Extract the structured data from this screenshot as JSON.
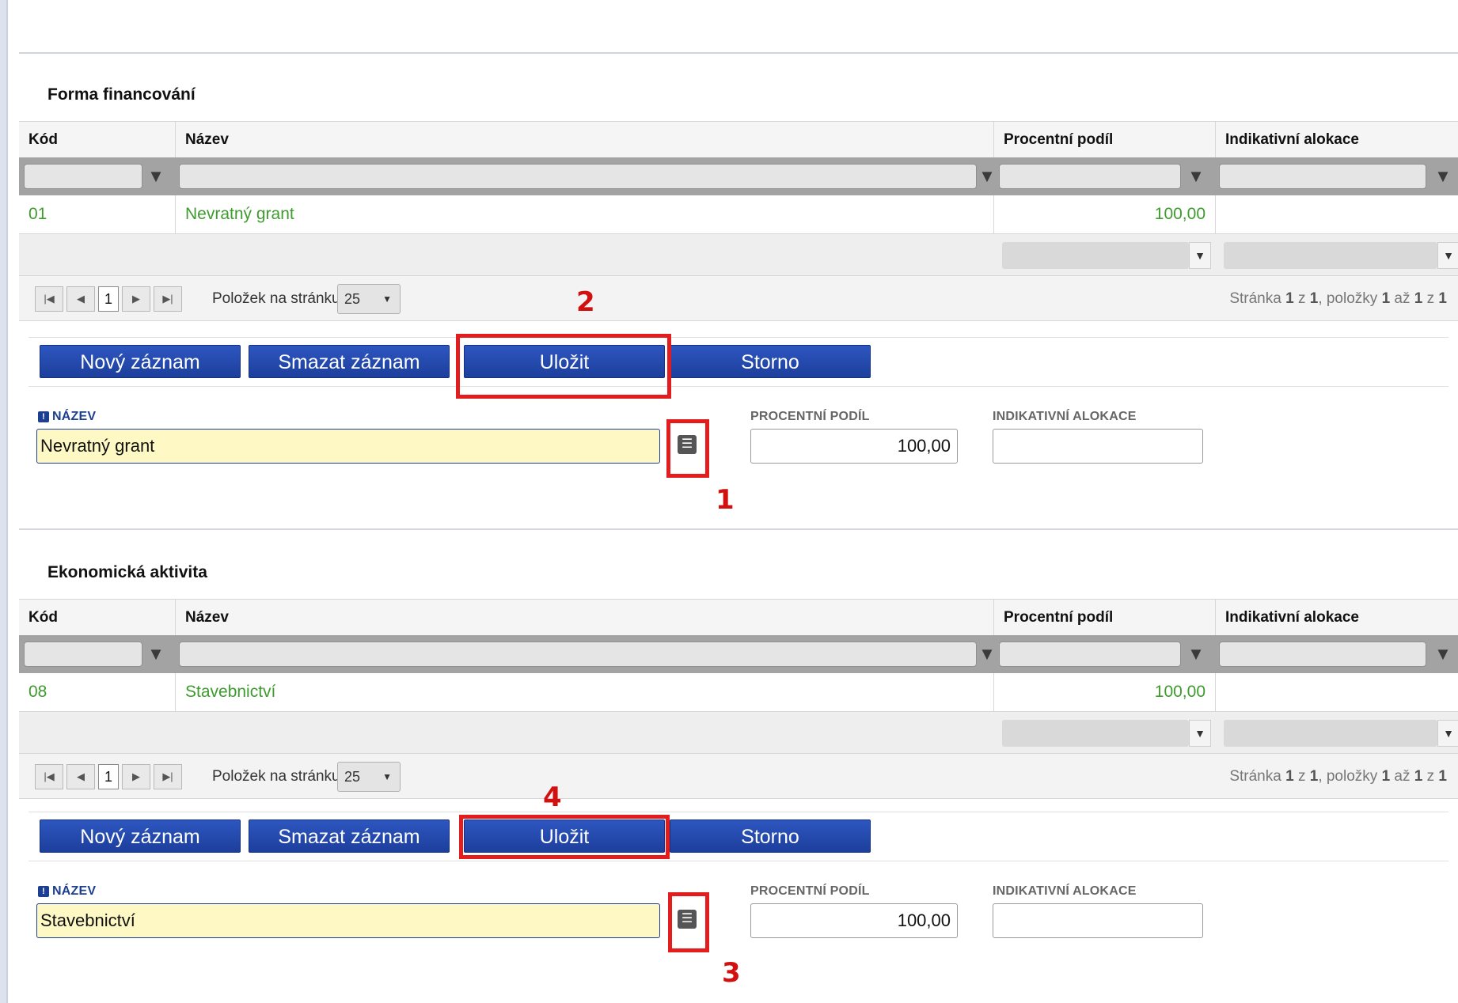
{
  "sections": [
    {
      "title": "Forma financování",
      "columns": [
        "Kód",
        "Název",
        "Procentní podíl",
        "Indikativní alokace"
      ],
      "row": {
        "kod": "01",
        "nazev": "Nevratný grant",
        "podil": "100,00",
        "alokace": ""
      },
      "pager": {
        "page": "1",
        "per_page_label": "Položek na stránku",
        "per_page": "25",
        "info_a": "Stránka ",
        "info_b": "1",
        "info_c": " z ",
        "info_d": "1",
        "info_e": ", položky ",
        "info_f": "1",
        "info_g": " až ",
        "info_h": "1",
        "info_i": " z ",
        "info_j": "1"
      },
      "buttons": {
        "new": "Nový záznam",
        "delete": "Smazat záznam",
        "save": "Uložit",
        "cancel": "Storno"
      },
      "form": {
        "nazev_label": "NÁZEV",
        "nazev_value": "Nevratný grant",
        "podil_label": "PROCENTNÍ PODÍL",
        "podil_value": "100,00",
        "alokace_label": "INDIKATIVNÍ ALOKACE",
        "alokace_value": ""
      },
      "annotations": {
        "list": "1",
        "save": "2"
      }
    },
    {
      "title": "Ekonomická aktivita",
      "columns": [
        "Kód",
        "Název",
        "Procentní podíl",
        "Indikativní alokace"
      ],
      "row": {
        "kod": "08",
        "nazev": "Stavebnictví",
        "podil": "100,00",
        "alokace": ""
      },
      "pager": {
        "page": "1",
        "per_page_label": "Položek na stránku",
        "per_page": "25",
        "info_a": "Stránka ",
        "info_b": "1",
        "info_c": " z ",
        "info_d": "1",
        "info_e": ", položky ",
        "info_f": "1",
        "info_g": " až ",
        "info_h": "1",
        "info_i": " z ",
        "info_j": "1"
      },
      "buttons": {
        "new": "Nový záznam",
        "delete": "Smazat záznam",
        "save": "Uložit",
        "cancel": "Storno"
      },
      "form": {
        "nazev_label": "NÁZEV",
        "nazev_value": "Stavebnictví",
        "podil_label": "PROCENTNÍ PODÍL",
        "podil_value": "100,00",
        "alokace_label": "INDIKATIVNÍ ALOKACE",
        "alokace_value": ""
      },
      "annotations": {
        "list": "3",
        "save": "4"
      }
    }
  ],
  "icons": {
    "filter": "filter-icon",
    "list": "list-icon",
    "first": "first-page-icon",
    "prev": "prev-page-icon",
    "next": "next-page-icon",
    "last": "last-page-icon",
    "caret": "chevron-down-icon"
  },
  "colors": {
    "accent": "#1d3f9c",
    "link_green": "#3e9b2e",
    "required_field": "#fdf8c4",
    "annotation_red": "#e31d1d"
  }
}
